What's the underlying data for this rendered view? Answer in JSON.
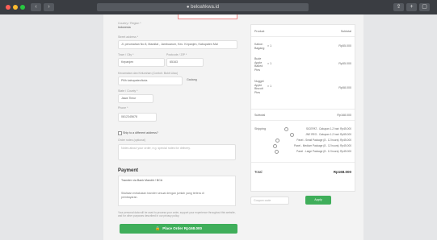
{
  "browser": {
    "url": "● beloahkwa.id",
    "back_label": "‹",
    "forward_label": "›"
  },
  "billing": {
    "country_label": "Country / Region *",
    "country_value": "Indonesia",
    "address_label": "Street address *",
    "address_value": "Jl. perumahan No 8, Marallat , Jambuarum, Kec. Kepanjen, Kabupaten Mal",
    "city_label": "Town / City *",
    "city_value": "Kepanjen",
    "postcode_label": "Postcode / ZIP *",
    "postcode_value": "65163",
    "province_label": "Kecamatan dan Kelurahan (Contoh: Bukit Lilau)",
    "province_value": "Pilih kabupaten/kota",
    "subdistrict_value": "Gadang",
    "state_label": "State / County *",
    "state_value": "Jawa Timur",
    "phone_label": "Phone *",
    "phone_value": "0812345678",
    "ship_diff_label": "Ship to a different address?",
    "notes_label": "Order notes (optional)",
    "notes_placeholder": "Notes about your order, e.g. special notes for delivery."
  },
  "payment": {
    "title": "Payment",
    "method_label": "Transfer via Bank Mandiri / BCA",
    "method_desc": "Silahkan melakukan transfer sesuai dengan jumlah yang tertera di pembayaran.",
    "privacy_text": "Your personal data will be used to process your order, support your experience throughout this website, and for other purposes described in our privacy policy.",
    "place_order_label": "Place Order Rp168.000"
  },
  "summary": {
    "product_header": "Product",
    "subtotal_header": "Subtotal",
    "items": [
      {
        "name": "Kabon Bagang",
        "qty": "× 1",
        "price": "Rp55.000"
      },
      {
        "name": "Bude Apple Baked Pies",
        "qty": "× 1",
        "price": "Rp55.000"
      },
      {
        "name": "Nugget Apple Biscuit Pies",
        "qty": "× 1",
        "price": "Rp58.000"
      }
    ],
    "subtotal_label": "Subtotal",
    "subtotal_value": "Rp168.000",
    "shipping_label": "Shipping",
    "shipping_options": [
      "SICEPAT - Cakupan 1-2 hari: Rp45.000",
      "JNE REG - Cakupan 1-2 hari: Rp55.000",
      "Paxel - Small Package (8 - 12 hours): Rp45.000",
      "Paxel - Medium Package (8 - 12 hours): Rp45.000",
      "Paxel - Large Package (8 - 12 hours): Rp45.000"
    ],
    "total_label": "Total",
    "total_value": "Rp168.000",
    "coupon_placeholder": "Coupon code",
    "apply_label": "Apply"
  }
}
